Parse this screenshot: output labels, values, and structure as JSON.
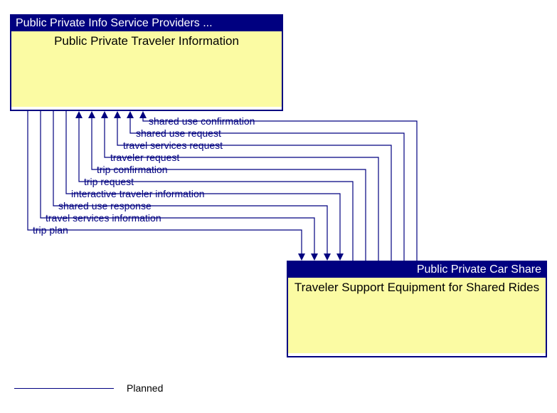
{
  "nodes": {
    "top": {
      "header": "Public Private Info Service Providers ...",
      "body": "Public Private Traveler Information"
    },
    "bottom": {
      "header": "Public Private Car Share",
      "body": "Traveler Support Equipment for Shared Rides"
    }
  },
  "flows_to_top": [
    "shared use confirmation",
    "shared use request",
    "travel services request",
    "traveler request",
    "trip confirmation",
    "trip request"
  ],
  "flows_to_bottom": [
    "interactive traveler information",
    "shared use response",
    "travel services information",
    "trip plan"
  ],
  "legend": {
    "label": "Planned"
  }
}
